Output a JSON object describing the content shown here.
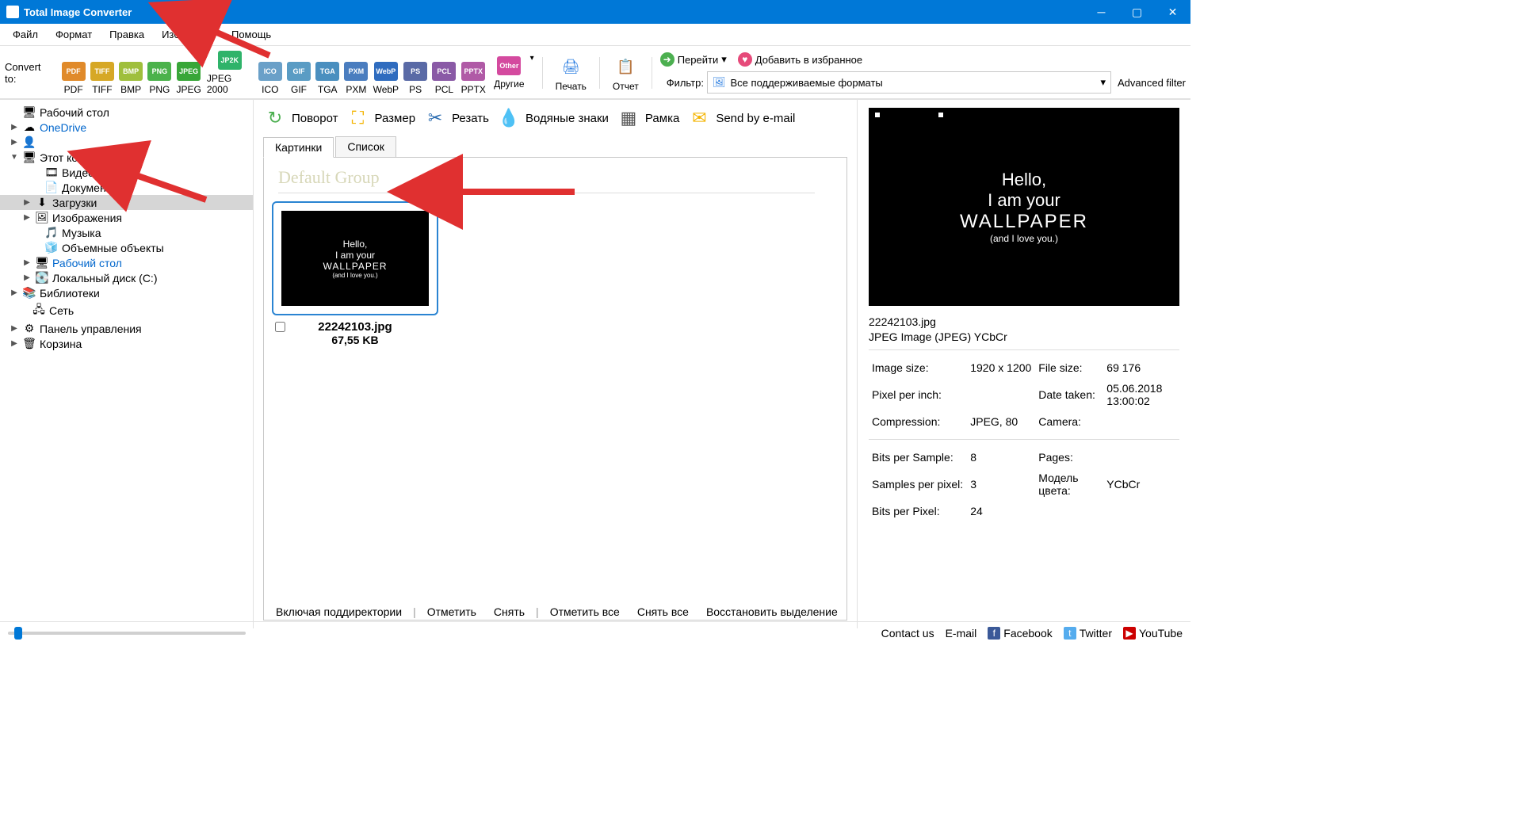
{
  "app": {
    "title": "Total Image Converter"
  },
  "menu": [
    "Файл",
    "Формат",
    "Правка",
    "Избранное",
    "Помощь"
  ],
  "toolbar": {
    "convert_label": "Convert to:",
    "formats": [
      {
        "label": "PDF",
        "color": "#e08a2a",
        "txt": "PDF"
      },
      {
        "label": "TIFF",
        "color": "#d6a826",
        "txt": "TIFF"
      },
      {
        "label": "BMP",
        "color": "#9fbf3c",
        "txt": "BMP"
      },
      {
        "label": "PNG",
        "color": "#4bb24b",
        "txt": "PNG"
      },
      {
        "label": "JPEG",
        "color": "#38a638",
        "txt": "JPEG"
      },
      {
        "label": "JPEG 2000",
        "color": "#2fb36a",
        "txt": "JP2K"
      },
      {
        "label": "ICO",
        "color": "#6aa0c8",
        "txt": "ICO"
      },
      {
        "label": "GIF",
        "color": "#5a9cc4",
        "txt": "GIF"
      },
      {
        "label": "TGA",
        "color": "#4a8fbf",
        "txt": "TGA"
      },
      {
        "label": "PXM",
        "color": "#4a7dbf",
        "txt": "PXM"
      },
      {
        "label": "WebP",
        "color": "#2f6cbf",
        "txt": "WebP"
      },
      {
        "label": "PS",
        "color": "#5a6aa6",
        "txt": "PS"
      },
      {
        "label": "PCL",
        "color": "#8a5aa6",
        "txt": "PCL"
      },
      {
        "label": "PPTX",
        "color": "#b05aa6",
        "txt": "PPTX"
      }
    ],
    "other": "Другие",
    "print": "Печать",
    "report": "Отчет",
    "go": "Перейти",
    "fav": "Добавить в избранное",
    "filter_label": "Фильтр:",
    "filter_value": "Все поддерживаемые форматы",
    "adv_filter": "Advanced filter"
  },
  "tree": [
    {
      "ind": 12,
      "arrow": "",
      "icon": "🖥",
      "label": "Рабочий стол"
    },
    {
      "ind": 12,
      "arrow": "▶",
      "icon": "☁",
      "label": "OneDrive",
      "link": true
    },
    {
      "ind": 12,
      "arrow": "▶",
      "icon": "👤",
      "label": ""
    },
    {
      "ind": 12,
      "arrow": "▼",
      "icon": "🖥",
      "label": "Этот компьютер"
    },
    {
      "ind": 40,
      "arrow": "",
      "icon": "🎞",
      "label": "Видео"
    },
    {
      "ind": 40,
      "arrow": "",
      "icon": "📄",
      "label": "Документы"
    },
    {
      "ind": 28,
      "arrow": "▶",
      "icon": "⬇",
      "label": "Загрузки",
      "selected": true
    },
    {
      "ind": 28,
      "arrow": "▶",
      "icon": "🖼",
      "label": "Изображения"
    },
    {
      "ind": 40,
      "arrow": "",
      "icon": "🎵",
      "label": "Музыка"
    },
    {
      "ind": 40,
      "arrow": "",
      "icon": "🧊",
      "label": "Объемные объекты"
    },
    {
      "ind": 28,
      "arrow": "▶",
      "icon": "🖥",
      "label": "Рабочий стол",
      "link": true
    },
    {
      "ind": 28,
      "arrow": "▶",
      "icon": "💽",
      "label": "Локальный диск (C:)"
    },
    {
      "ind": 12,
      "arrow": "▶",
      "icon": "📚",
      "label": "Библиотеки"
    },
    {
      "ind": 24,
      "arrow": "",
      "icon": "🖧",
      "label": "Сеть"
    },
    {
      "ind": 12,
      "arrow": "▶",
      "icon": "⚙",
      "label": "Панель управления"
    },
    {
      "ind": 12,
      "arrow": "▶",
      "icon": "🗑",
      "label": "Корзина"
    }
  ],
  "ops": [
    {
      "icon": "↻",
      "label": "Поворот",
      "color": "#4caf50"
    },
    {
      "icon": "⛶",
      "label": "Размер",
      "color": "#f4b400"
    },
    {
      "icon": "✂",
      "label": "Резать",
      "color": "#2a6bb0"
    },
    {
      "icon": "💧",
      "label": "Водяные знаки",
      "color": "#d28a2a"
    },
    {
      "icon": "▦",
      "label": "Рамка",
      "color": "#555"
    },
    {
      "icon": "✉",
      "label": "Send by e-mail",
      "color": "#f4b400"
    }
  ],
  "tabs": {
    "pictures": "Картинки",
    "list": "Список"
  },
  "group": {
    "title": "Default Group"
  },
  "thumb": {
    "name": "22242103.jpg",
    "size": "67,55 KB",
    "txt1": "Hello,",
    "txt2": "I am your",
    "txt3": "WALLPAPER",
    "txt4": "(and I love you.)"
  },
  "detail": {
    "name": "22242103.jpg",
    "type": "JPEG Image (JPEG) YCbCr",
    "rows1": [
      [
        "Image size:",
        "1920 x 1200",
        "File size:",
        "69 176"
      ],
      [
        "Pixel per inch:",
        "",
        "Date taken:",
        "05.06.2018 13:00:02"
      ],
      [
        "Compression:",
        "JPEG, 80",
        "Camera:",
        ""
      ]
    ],
    "rows2": [
      [
        "Bits per Sample:",
        "8",
        "Pages:",
        ""
      ],
      [
        "Samples per pixel:",
        "3",
        "Модель цвета:",
        "YCbCr"
      ],
      [
        "Bits per Pixel:",
        "24",
        "",
        ""
      ]
    ]
  },
  "bottom": {
    "subdirs": "Включая поддиректории",
    "check": "Отметить",
    "uncheck": "Снять",
    "checkall": "Отметить все",
    "uncheckall": "Снять все",
    "restore": "Восстановить выделение"
  },
  "status": {
    "contact": "Contact us",
    "email": "E-mail",
    "fb": "Facebook",
    "tw": "Twitter",
    "yt": "YouTube"
  }
}
